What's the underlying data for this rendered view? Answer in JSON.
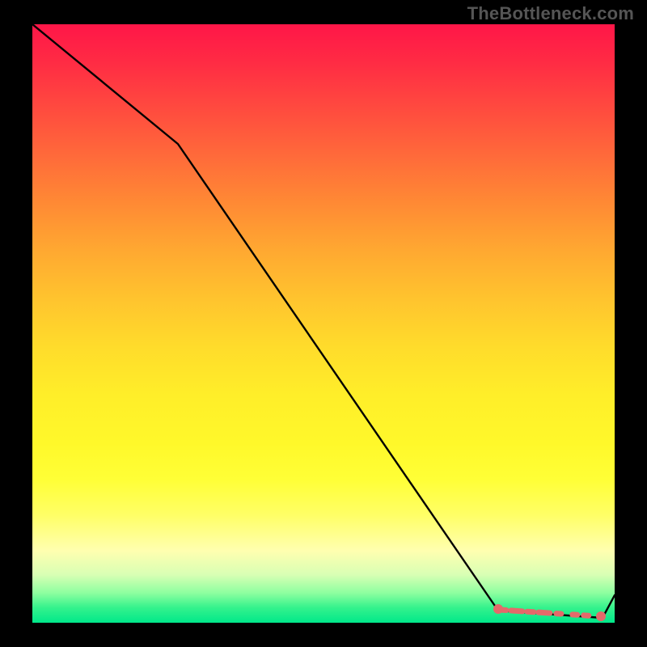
{
  "watermark": "TheBottleneck.com",
  "chart_data": {
    "type": "line",
    "title": "",
    "xlabel": "",
    "ylabel": "",
    "ylim": [
      0,
      100
    ],
    "xlim": [
      0,
      100
    ],
    "series": [
      {
        "name": "curve",
        "x": [
          0,
          25,
          80,
          98,
          100
        ],
        "y": [
          100,
          80,
          2,
          0.8,
          5
        ]
      }
    ],
    "highlight_segment": {
      "x": [
        80,
        98
      ],
      "y": [
        2,
        0.8
      ]
    },
    "highlight_point": {
      "x": 98,
      "y": 0.8
    },
    "gradient_colors": {
      "top": "#ff1648",
      "mid": "#ffff36",
      "bottom": "#00e88a"
    }
  }
}
